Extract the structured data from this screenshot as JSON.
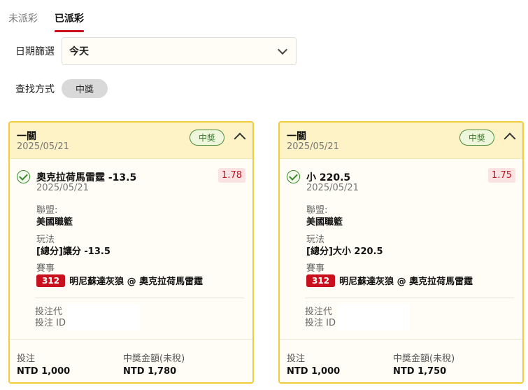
{
  "tabs": [
    {
      "label": "未派彩",
      "active": false
    },
    {
      "label": "已派彩",
      "active": true
    }
  ],
  "filter": {
    "label": "日期篩選",
    "value": "今天"
  },
  "search_method": {
    "label": "查找方式",
    "option": "中獎"
  },
  "cards": [
    {
      "header_title": "一關",
      "header_date": "2025/05/21",
      "status_badge": "中獎",
      "selection": "奧克拉荷馬雷霆 -13.5",
      "selection_date": "2025/05/21",
      "odds": "1.78",
      "league_label": "聯盟:",
      "league": "美國職籃",
      "play_label": "玩法",
      "play": "[總分]讓分 -13.5",
      "event_label": "賽事",
      "event_no": "312",
      "event": "明尼蘇達灰狼 @ 奧克拉荷馬雷霆",
      "agent_label": "投注代",
      "bet_id_label": "投注 ID",
      "stake_label": "投注",
      "stake": "NTD 1,000",
      "payout_label": "中獎金額(未稅)",
      "payout": "NTD 1,780"
    },
    {
      "header_title": "一關",
      "header_date": "2025/05/21",
      "status_badge": "中獎",
      "selection": "小 220.5",
      "selection_date": "2025/05/21",
      "odds": "1.75",
      "league_label": "聯盟:",
      "league": "美國職籃",
      "play_label": "玩法",
      "play": "[總分]大小 220.5",
      "event_label": "賽事",
      "event_no": "312",
      "event": "明尼蘇達灰狼 @ 奧克拉荷馬雷霆",
      "agent_label": "投注代",
      "bet_id_label": "投注 ID",
      "stake_label": "投注",
      "stake": "NTD 1,000",
      "payout_label": "中獎金額(未稅)",
      "payout": "NTD 1,750"
    }
  ],
  "icons": {
    "check": "check-circle-icon",
    "collapse": "chevron-up-icon",
    "dropdown": "chevron-down-icon"
  },
  "colors": {
    "accent_red": "#c8101e",
    "card_border": "#f2cc3a",
    "card_header": "#fdf3c6",
    "win_green": "#3c7a2c"
  }
}
